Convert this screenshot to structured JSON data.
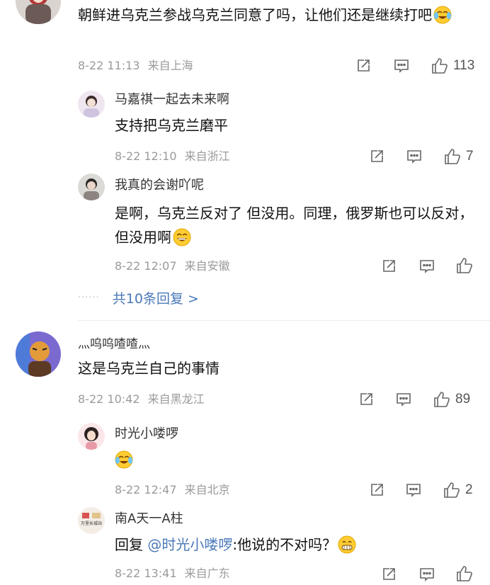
{
  "comments": [
    {
      "text": "朝鲜进乌克兰参战乌克兰同意了吗，让他们还是继续打吧",
      "date": "8-22 11:13",
      "location": "来自上海",
      "likes": "113",
      "emoji": "crying-laughing-emoji",
      "replies": [
        {
          "user": "马嘉祺一起去未来啊",
          "text": "支持把乌克兰磨平",
          "date": "8-22 12:10",
          "location": "来自浙江",
          "likes": "7"
        },
        {
          "user": "我真的会谢吖呢",
          "text": "是啊，乌克兰反对了 但没用。同理，俄罗斯也可以反对，但没用啊",
          "date": "8-22 12:07",
          "location": "来自安徽",
          "likes": "",
          "emoji": "grinning-sweat-emoji"
        }
      ],
      "more_replies": "共10条回复 >",
      "dots": "······"
    },
    {
      "user": "灬呜呜喳喳灬",
      "text": "这是乌克兰自己的事情",
      "date": "8-22 10:42",
      "location": "来自黑龙江",
      "likes": "89",
      "replies": [
        {
          "user": "时光小喽啰",
          "text": "",
          "date": "8-22 12:47",
          "location": "来自北京",
          "likes": "2",
          "emoji": "crying-laughing-emoji"
        },
        {
          "user": "南A天一A柱",
          "reply_prefix": "回复",
          "mention": "@时光小喽啰",
          "text": ":他说的不对吗？",
          "date": "8-22 13:41",
          "location": "来自广东",
          "likes": "",
          "emoji": "grin-emoji",
          "avatar_text": "万里长城站"
        }
      ]
    }
  ],
  "icons": {
    "share": "share-icon",
    "comment": "comment-icon",
    "like": "thumbs-up-icon"
  },
  "colors": {
    "link": "#4a78b8",
    "meta": "#9a9a9a",
    "divider": "#ececec"
  }
}
